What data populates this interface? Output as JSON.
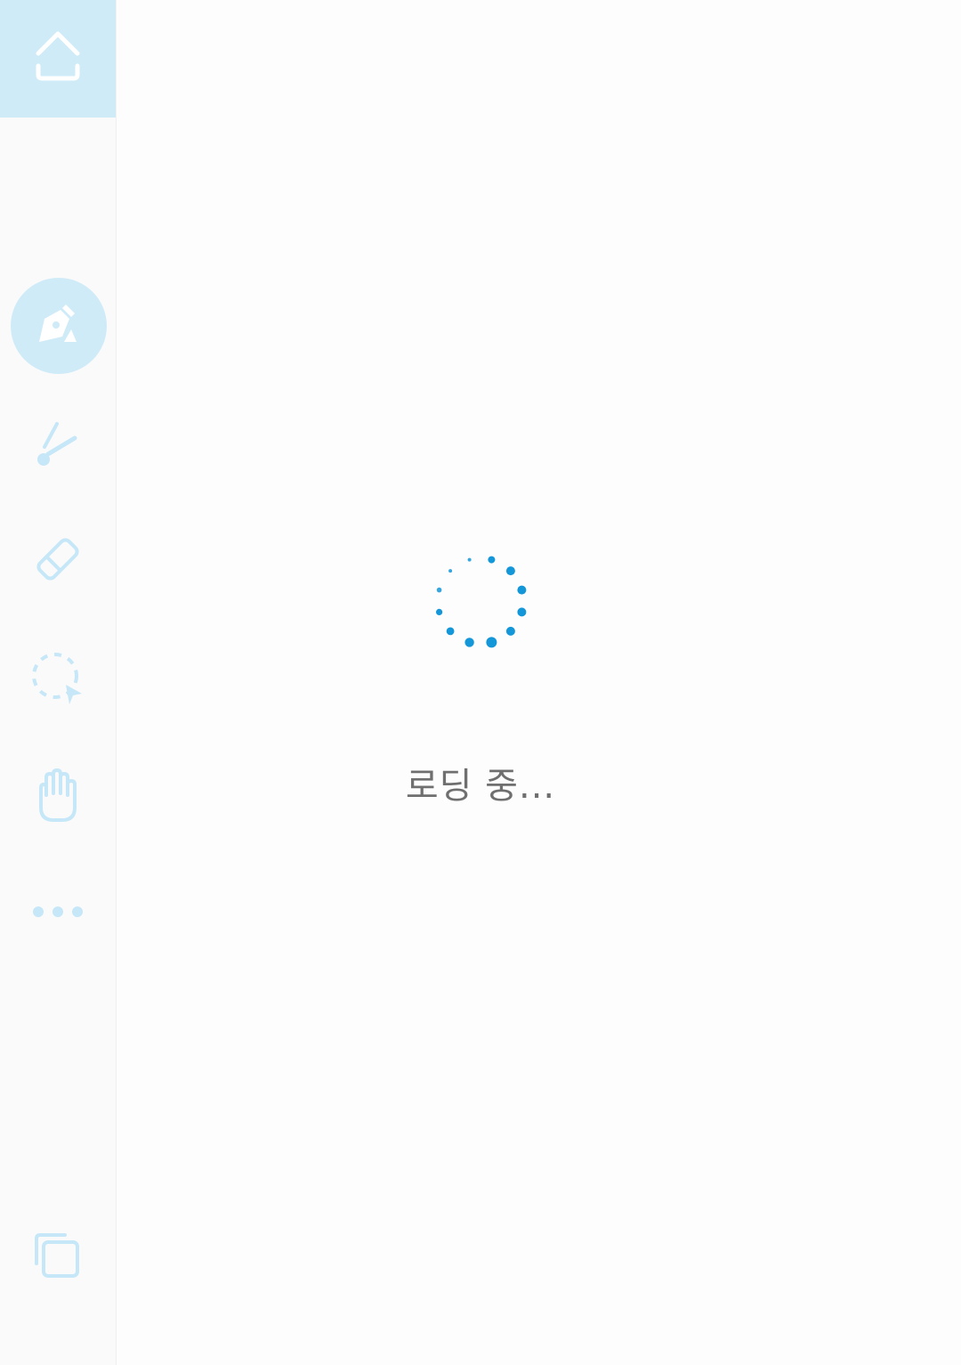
{
  "colors": {
    "accent_light": "#cfebf8",
    "icon_light": "#c6e7f7",
    "spinner": "#1497d9",
    "text_muted": "#6f6f6f"
  },
  "sidebar": {
    "items": [
      {
        "icon": "home-icon",
        "active": true
      },
      {
        "icon": "pen-nib-icon",
        "active": true
      },
      {
        "icon": "highlighter-icon",
        "active": false
      },
      {
        "icon": "eraser-icon",
        "active": false
      },
      {
        "icon": "lasso-select-icon",
        "active": false
      },
      {
        "icon": "hand-icon",
        "active": false
      },
      {
        "icon": "more-icon",
        "active": false
      },
      {
        "icon": "page-layout-icon",
        "active": false
      }
    ]
  },
  "loading": {
    "text": "로딩 중..."
  }
}
